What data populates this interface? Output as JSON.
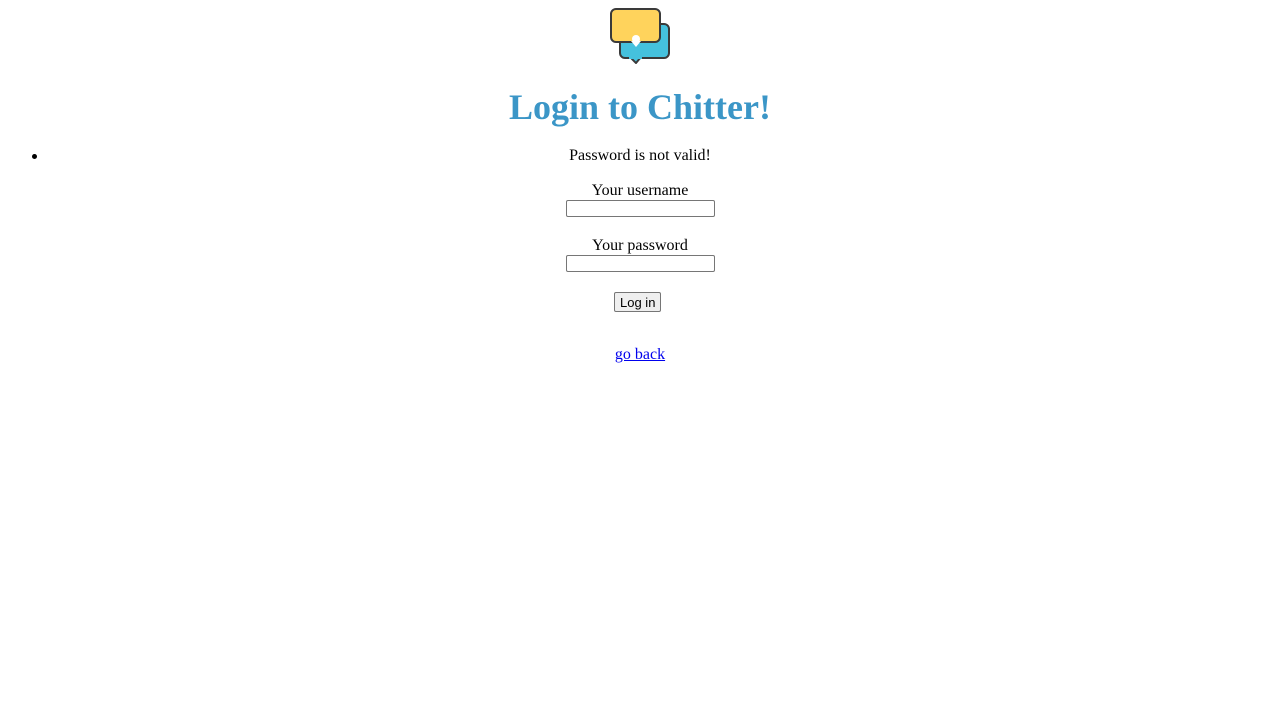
{
  "header": {
    "logo_icon": "chat-bubbles-icon",
    "title": "Login to Chitter!",
    "title_color": "#3b96c7"
  },
  "errors": [
    "Password is not valid!"
  ],
  "form": {
    "username_label": "Your username",
    "username_value": "",
    "password_label": "Your password",
    "password_value": "",
    "submit_label": "Log in"
  },
  "footer": {
    "back_link": "go back",
    "link_color": "#0000ee"
  }
}
